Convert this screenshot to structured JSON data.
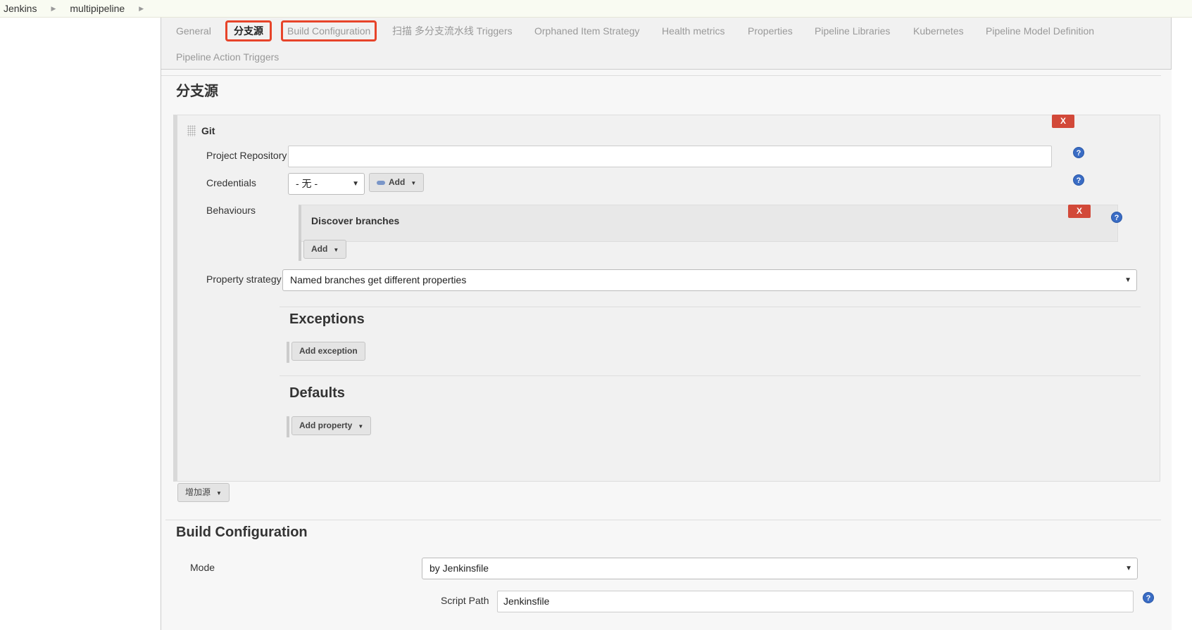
{
  "breadcrumb": [
    "Jenkins",
    "multipipeline"
  ],
  "tabs": {
    "general": "General",
    "branch_sources": "分支源",
    "build_configuration": "Build Configuration",
    "scan_triggers": "扫描 多分支流水线 Triggers",
    "orphaned": "Orphaned Item Strategy",
    "health": "Health metrics",
    "properties": "Properties",
    "libraries": "Pipeline Libraries",
    "kubernetes": "Kubernetes",
    "model_def": "Pipeline Model Definition",
    "action_triggers": "Pipeline Action Triggers"
  },
  "branch_sources": {
    "title": "分支源",
    "git": {
      "title": "Git",
      "delete": "X",
      "project_repository_label": "Project Repository",
      "project_repository_value": "",
      "credentials_label": "Credentials",
      "credentials_value": "- 无 -",
      "credentials_add": "Add",
      "behaviours_label": "Behaviours",
      "behaviour_item": "Discover branches",
      "behaviour_delete": "X",
      "behaviour_add": "Add",
      "property_strategy_label": "Property strategy",
      "property_strategy_value": "Named branches get different properties",
      "exceptions_title": "Exceptions",
      "add_exception": "Add exception",
      "defaults_title": "Defaults",
      "add_property": "Add property"
    },
    "add_source": "增加源"
  },
  "build_configuration": {
    "title": "Build Configuration",
    "mode_label": "Mode",
    "mode_value": "by Jenkinsfile",
    "script_path_label": "Script Path",
    "script_path_value": "Jenkinsfile"
  },
  "help_glyph": "?",
  "colors": {
    "highlight": "#e7442a",
    "delete": "#d24939",
    "help": "#3a6cc4"
  }
}
